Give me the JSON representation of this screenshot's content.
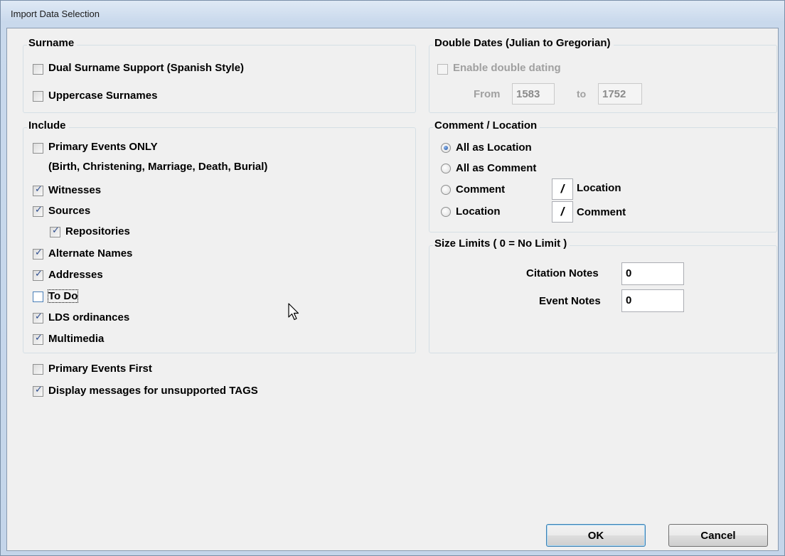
{
  "window": {
    "title": "Import Data Selection"
  },
  "surname": {
    "title": "Surname",
    "dual_surname": {
      "label": "Dual Surname Support (Spanish Style)",
      "checked": false
    },
    "uppercase": {
      "label": "Uppercase Surnames",
      "checked": false
    }
  },
  "double_dates": {
    "title": "Double Dates (Julian to Gregorian)",
    "enable": {
      "label": "Enable double dating",
      "checked": false,
      "enabled": false
    },
    "from_label": "From",
    "from_value": "1583",
    "to_label": "to",
    "to_value": "1752"
  },
  "include": {
    "title": "Include",
    "primary_events_only": {
      "label": "Primary Events ONLY",
      "checked": false
    },
    "primary_events_note": "(Birth, Christening, Marriage, Death, Burial)",
    "witnesses": {
      "label": "Witnesses",
      "checked": true
    },
    "sources": {
      "label": "Sources",
      "checked": true
    },
    "repositories": {
      "label": "Repositories",
      "checked": true
    },
    "alternate_names": {
      "label": "Alternate Names",
      "checked": true
    },
    "addresses": {
      "label": "Addresses",
      "checked": true
    },
    "to_do": {
      "label": "To Do",
      "checked": false
    },
    "lds_ordinances": {
      "label": "LDS ordinances",
      "checked": true
    },
    "multimedia": {
      "label": "Multimedia",
      "checked": true
    }
  },
  "comment_location": {
    "title": "Comment / Location",
    "all_as_location": {
      "label": "All as Location",
      "selected": true
    },
    "all_as_comment": {
      "label": "All as Comment",
      "selected": false
    },
    "comment_location": {
      "label": "Comment",
      "separator": "/",
      "label2": "Location",
      "selected": false
    },
    "location_comment": {
      "label": "Location",
      "separator": "/",
      "label2": "Comment",
      "selected": false
    }
  },
  "size_limits": {
    "title": "Size Limits ( 0 = No Limit )",
    "citation_notes": {
      "label": "Citation Notes",
      "value": "0"
    },
    "event_notes": {
      "label": "Event Notes",
      "value": "0"
    }
  },
  "primary_events_first": {
    "label": "Primary Events First",
    "checked": false
  },
  "display_messages": {
    "label": "Display messages for unsupported TAGS",
    "checked": true
  },
  "buttons": {
    "ok": "OK",
    "cancel": "Cancel"
  }
}
